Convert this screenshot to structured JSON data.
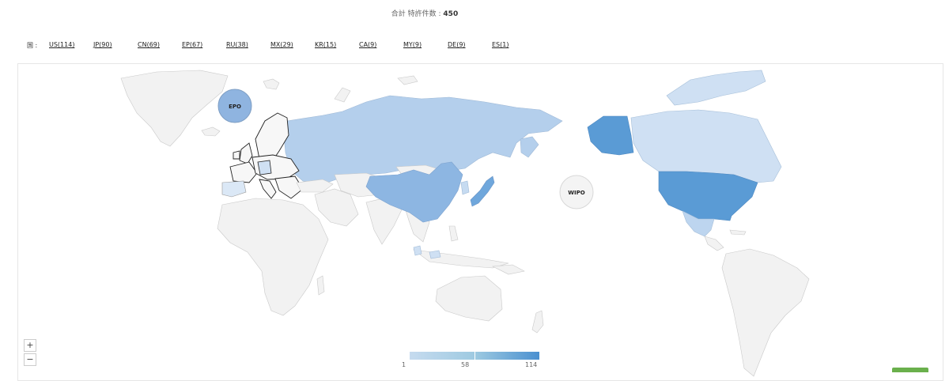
{
  "header": {
    "total_label": "合計 特許件数 :",
    "total_value": "450"
  },
  "filter": {
    "label": "国 :",
    "countries": [
      {
        "code": "US",
        "count": 114,
        "text": "US(114)"
      },
      {
        "code": "JP",
        "count": 90,
        "text": "JP(90)"
      },
      {
        "code": "CN",
        "count": 69,
        "text": "CN(69)"
      },
      {
        "code": "EP",
        "count": 67,
        "text": "EP(67)"
      },
      {
        "code": "RU",
        "count": 38,
        "text": "RU(38)"
      },
      {
        "code": "MX",
        "count": 29,
        "text": "MX(29)"
      },
      {
        "code": "KR",
        "count": 15,
        "text": "KR(15)"
      },
      {
        "code": "CA",
        "count": 9,
        "text": "CA(9)"
      },
      {
        "code": "MY",
        "count": 9,
        "text": "MY(9)"
      },
      {
        "code": "DE",
        "count": 9,
        "text": "DE(9)"
      },
      {
        "code": "ES",
        "count": 1,
        "text": "ES(1)"
      }
    ]
  },
  "map": {
    "bubbles": [
      {
        "label": "EPO",
        "count": 67,
        "color": "#8fb4e0"
      },
      {
        "label": "WIPO",
        "count": 0,
        "color": "#f4f4f4"
      }
    ],
    "region_colors": {
      "US": "#5a9bd5",
      "JP": "#6fa7dc",
      "CN": "#8db6e2",
      "RU": "#b4cfec",
      "MX": "#bdd5ef",
      "KR": "#c6dbf1",
      "CA": "#cfe0f3",
      "MY": "#cfe0f3",
      "ES": "#dbe8f6",
      "other": "#f2f2f2"
    },
    "zoom_in": "+",
    "zoom_out": "−"
  },
  "legend": {
    "min": "1",
    "mid": "58",
    "max": "114",
    "color_low": "#c6dbef",
    "color_high": "#4a90d0"
  }
}
